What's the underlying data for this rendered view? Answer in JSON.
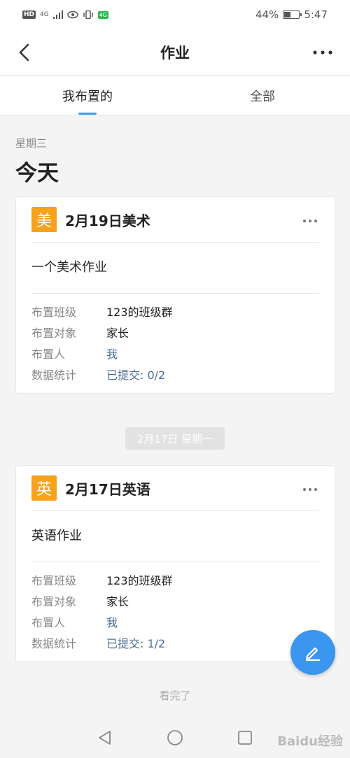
{
  "status_bar": {
    "badge": "HD",
    "net": "4G",
    "chip": "4G",
    "battery": "44%",
    "battery_level": 0.44,
    "time": "5:47"
  },
  "nav": {
    "title": "作业",
    "back_icon": "chevron-left-icon",
    "more_icon": "more-horizontal-icon"
  },
  "tabs": [
    {
      "label": "我布置的",
      "active": true
    },
    {
      "label": "全部",
      "active": false
    }
  ],
  "date_header": {
    "weekday": "星期三",
    "label": "今天"
  },
  "cards": [
    {
      "badge": "美",
      "title": "2月19日美术",
      "description": "一个美术作业",
      "rows": [
        {
          "label": "布置班级",
          "value": "123的班级群"
        },
        {
          "label": "布置对象",
          "value": "家长"
        },
        {
          "label": "布置人",
          "value": "我"
        },
        {
          "label": "数据统计",
          "value": "已提交: 0/2"
        }
      ]
    },
    {
      "badge": "英",
      "title": "2月17日英语",
      "description": "英语作业",
      "rows": [
        {
          "label": "布置班级",
          "value": "123的班级群"
        },
        {
          "label": "布置对象",
          "value": "家长"
        },
        {
          "label": "布置人",
          "value": "我"
        },
        {
          "label": "数据统计",
          "value": "已提交: 1/2"
        }
      ]
    }
  ],
  "date_separator": "2月17日 星期一",
  "end_text": "看完了",
  "watermark": "Baidu经验",
  "colors": {
    "accent": "#3b9cf5",
    "badge": "#f8a21c",
    "fab": "#3a96ef"
  }
}
